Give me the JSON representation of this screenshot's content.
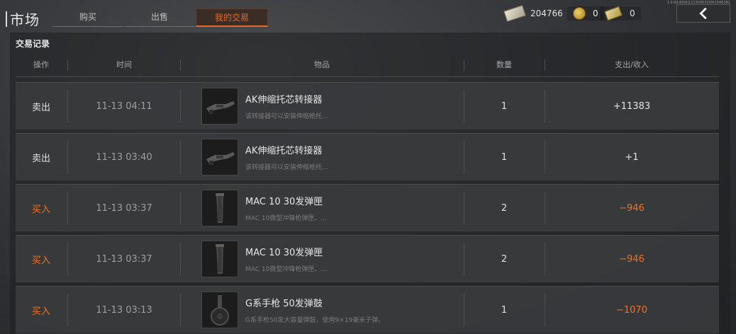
{
  "header": {
    "title": "市场",
    "tabs": [
      {
        "label": "购买",
        "active": false
      },
      {
        "label": "出售",
        "active": false
      },
      {
        "label": "我的交易",
        "active": true
      }
    ],
    "currencies": {
      "cash": "204766",
      "coins": "0",
      "tickets": "0"
    },
    "version": "1.0.60.60|6|11130453|3061566381",
    "back_icon": "chevron-left-icon"
  },
  "section": {
    "title": "交易记录",
    "columns": {
      "action": "操作",
      "time": "时间",
      "item": "物品",
      "qty": "数量",
      "amount": "支出/收入"
    }
  },
  "rows": [
    {
      "action": "卖出",
      "type": "sell",
      "time": "11-13 04:11",
      "item_name": "AK伸缩托芯转接器",
      "item_desc": "该转接器可以安装伸缩枪托...",
      "qty": "1",
      "amount": "+11383",
      "thumb": "stock-adapter"
    },
    {
      "action": "卖出",
      "type": "sell",
      "time": "11-13 03:40",
      "item_name": "AK伸缩托芯转接器",
      "item_desc": "该转接器可以安装伸缩枪托...",
      "qty": "1",
      "amount": "+1",
      "thumb": "stock-adapter"
    },
    {
      "action": "买入",
      "type": "buy",
      "time": "11-13 03:37",
      "item_name": "MAC 10 30发弹匣",
      "item_desc": "MAC 10微型冲锋枪弹匣。...",
      "qty": "2",
      "amount": "−946",
      "thumb": "magazine"
    },
    {
      "action": "买入",
      "type": "buy",
      "time": "11-13 03:37",
      "item_name": "MAC 10 30发弹匣",
      "item_desc": "MAC 10微型冲锋枪弹匣。...",
      "qty": "2",
      "amount": "−946",
      "thumb": "magazine"
    },
    {
      "action": "买入",
      "type": "buy",
      "time": "11-13 03:13",
      "item_name": "G系手枪 50发弹鼓",
      "item_desc": "G系手枪50发大容量弹鼓，使用9×19毫米子弹。",
      "qty": "1",
      "amount": "−1070",
      "thumb": "drum"
    }
  ],
  "colors": {
    "accent": "#e8742d",
    "sell_text": "#e0e0e0",
    "time_text": "#9e9e9e"
  }
}
